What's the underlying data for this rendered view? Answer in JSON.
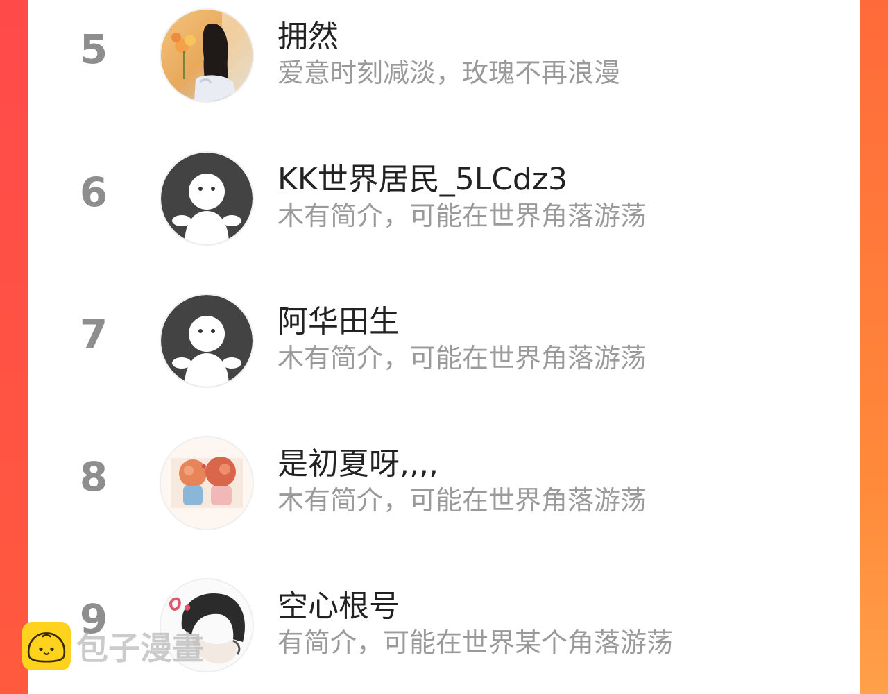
{
  "ranking": [
    {
      "rank": "5",
      "name": "拥然",
      "bio": "爱意时刻减淡，玫瑰不再浪漫",
      "avatar": "photo-girl-flowers-avatar"
    },
    {
      "rank": "6",
      "name": "KK世界居民_5LCdz3",
      "bio": "木有简介，可能在世界角落游荡",
      "avatar": "default-person-avatar"
    },
    {
      "rank": "7",
      "name": "阿华田生",
      "bio": "木有简介，可能在世界角落游荡",
      "avatar": "default-person-avatar"
    },
    {
      "rank": "8",
      "name": "是初夏呀,,,,",
      "bio": "木有简介，可能在世界角落游荡",
      "avatar": "cartoon-couple-avatar"
    },
    {
      "rank": "9",
      "name": "空心根号",
      "bio": "有简介，可能在世界某个角落游荡",
      "avatar": "sketch-boy-avatar"
    }
  ],
  "watermark": {
    "text": "包子漫畫",
    "icon": "bun-logo-icon"
  },
  "colors": {
    "accent_left": "#ff4a4a",
    "accent_right": "#ff8a3a",
    "rank": "#8e8e8e",
    "bio": "#9a9a9a"
  }
}
